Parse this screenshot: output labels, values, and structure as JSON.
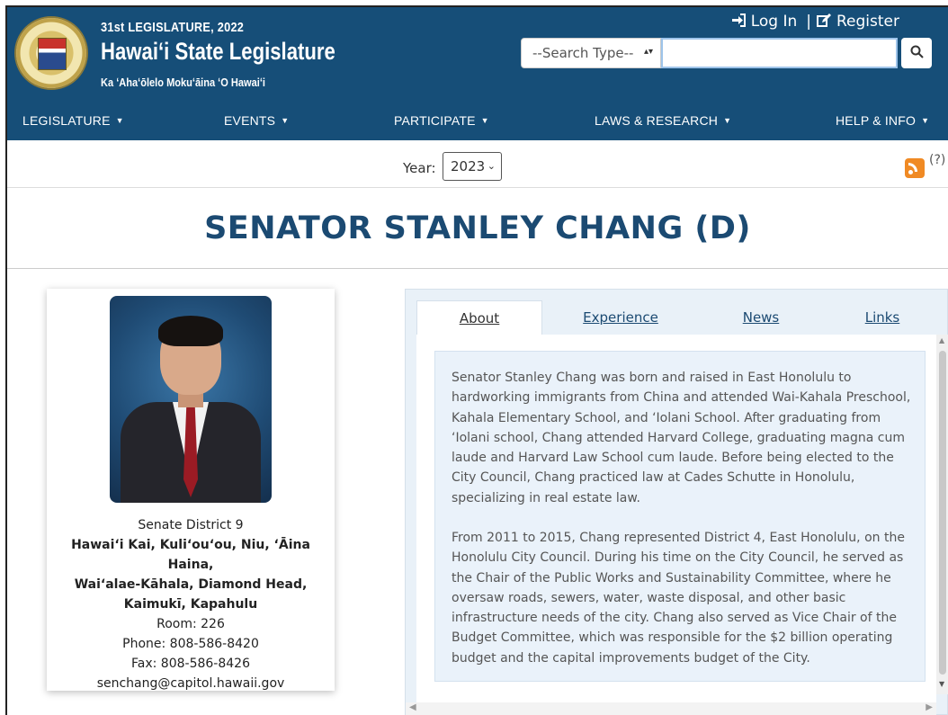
{
  "header": {
    "legislature_year": "31st LEGISLATURE, 2022",
    "site_title": "Hawai‘i State Legislature",
    "subtitle": "Ka ʻAhaʻōlelo Mokuʻāina ʻO Hawaiʻi",
    "login_label": "Log In",
    "separator": "|",
    "register_label": "Register",
    "search_type_placeholder": "--Search Type--",
    "search_value": "",
    "colors": {
      "header_bg": "#164e78",
      "title_color": "#1b4a72"
    }
  },
  "nav": {
    "items": [
      {
        "label": "LEGISLATURE"
      },
      {
        "label": "EVENTS"
      },
      {
        "label": "PARTICIPATE"
      },
      {
        "label": "LAWS & RESEARCH"
      },
      {
        "label": "HELP & INFO"
      }
    ]
  },
  "year_bar": {
    "label": "Year:",
    "selected_year": "2023",
    "help": "(?)"
  },
  "page": {
    "title": "SENATOR STANLEY CHANG (D)"
  },
  "profile": {
    "district": "Senate District 9",
    "areas": [
      "Hawai‘i Kai, Kuli‘ou‘ou, Niu, ‘Āina Haina,",
      "Wai‘alae-Kāhala, Diamond Head,",
      "Kaimukī, Kapahulu"
    ],
    "room": "Room: 226",
    "phone": "Phone: 808-586-8420",
    "fax": "Fax: 808-586-8426",
    "email": "senchang@capitol.hawaii.gov"
  },
  "tabs": {
    "items": [
      {
        "label": "About",
        "active": true
      },
      {
        "label": "Experience",
        "active": false
      },
      {
        "label": "News",
        "active": false
      },
      {
        "label": "Links",
        "active": false
      }
    ],
    "about_paragraphs": [
      "Senator Stanley Chang was born and raised in East Honolulu to hardworking immigrants from China and attended Wai-Kahala Preschool, Kahala Elementary School, and ‘Iolani School. After graduating from ‘Iolani school, Chang attended Harvard College, graduating magna cum laude and Harvard Law School cum laude. Before being elected to the City Council, Chang practiced law at Cades Schutte in Honolulu, specializing in real estate law.",
      "From 2011 to 2015, Chang represented District 4, East Honolulu, on the Honolulu City Council. During his time on the City Council, he served as the Chair of the Public Works and Sustainability Committee, where he oversaw roads, sewers, water, waste disposal, and other basic infrastructure needs of the city. Chang also served as Vice Chair of the Budget Committee, which was responsible for the $2 billion operating budget and the capital improvements budget of the City."
    ]
  },
  "icons": {
    "login": "sign-in-icon",
    "register": "edit-icon",
    "search": "search-icon",
    "rss": "rss-icon"
  }
}
